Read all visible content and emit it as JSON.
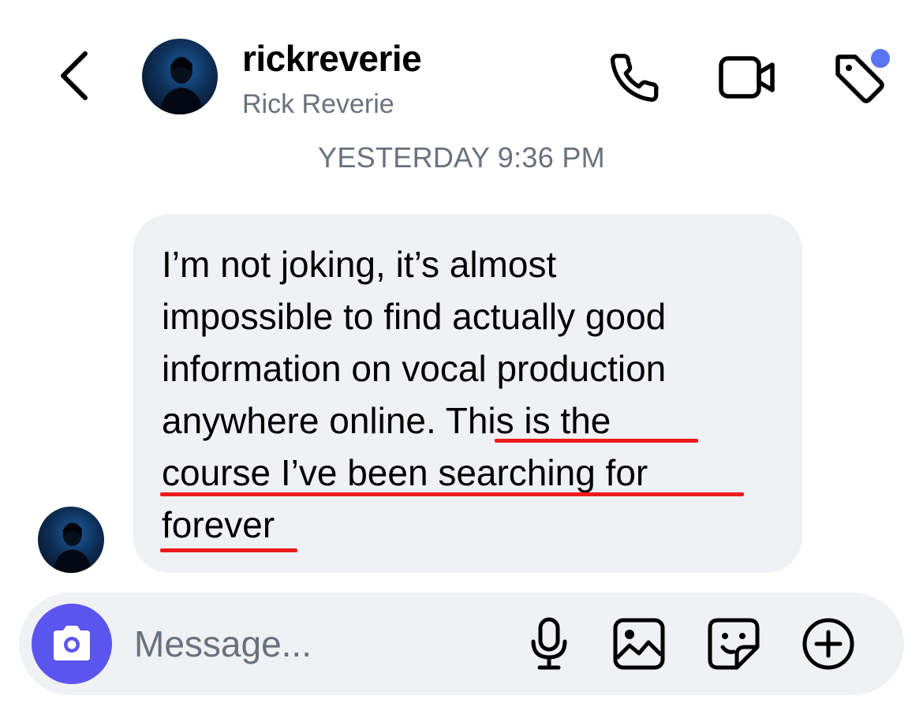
{
  "header": {
    "username": "rickreverie",
    "display_name": "Rick Reverie",
    "notification_dot_color": "#5b74f5",
    "icons": [
      "chevron-left-icon",
      "phone-icon",
      "video-camera-icon",
      "tag-icon"
    ]
  },
  "thread": {
    "timestamp": "YESTERDAY 9:36 PM",
    "message": {
      "lines": [
        "I’m not joking, it’s almost",
        "impossible to find actually good",
        "information on vocal production",
        "anywhere online. ",
        "This is the",
        "course I’ve been searching for",
        "forever"
      ],
      "underline_color": "#ee1c1c",
      "bubble_color": "#f0f1f4"
    }
  },
  "composer": {
    "placeholder": "Message...",
    "camera_button_color": "#5b55f0",
    "icons": [
      "camera-icon",
      "microphone-icon",
      "image-icon",
      "sticker-icon",
      "plus-circle-icon"
    ]
  }
}
